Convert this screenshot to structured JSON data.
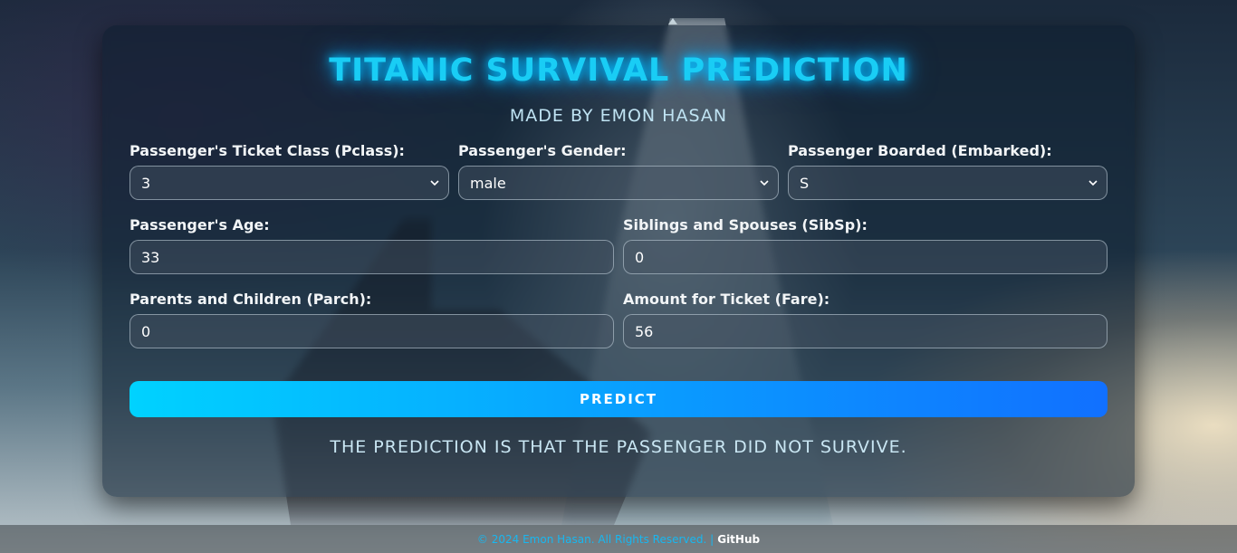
{
  "header": {
    "title": "TITANIC SURVIVAL PREDICTION",
    "subtitle": "MADE BY EMON HASAN"
  },
  "form": {
    "pclass": {
      "label": "Passenger's Ticket Class (Pclass):",
      "value": "3"
    },
    "sex": {
      "label": "Passenger's Gender:",
      "value": "male"
    },
    "embarked": {
      "label": "Passenger Boarded (Embarked):",
      "value": "S"
    },
    "age": {
      "label": "Passenger's Age:",
      "value": "33"
    },
    "sibsp": {
      "label": "Siblings and Spouses (SibSp):",
      "value": "0"
    },
    "parch": {
      "label": "Parents and Children (Parch):",
      "value": "0"
    },
    "fare": {
      "label": "Amount for Ticket (Fare):",
      "value": "56"
    },
    "predict_label": "PREDICT"
  },
  "result": {
    "text": "THE PREDICTION IS THAT THE PASSENGER DID NOT SURVIVE."
  },
  "footer": {
    "copyright": "© 2024 Emon Hasan. All Rights Reserved. |",
    "github_link": "GitHub"
  },
  "colors": {
    "title_glow": "#19cdf5",
    "button_start": "#00d2ff",
    "button_end": "#1170ff"
  },
  "icons": {
    "select_arrow": "chevron-down-icon",
    "scroll_arrow": "caret-up-icon"
  }
}
